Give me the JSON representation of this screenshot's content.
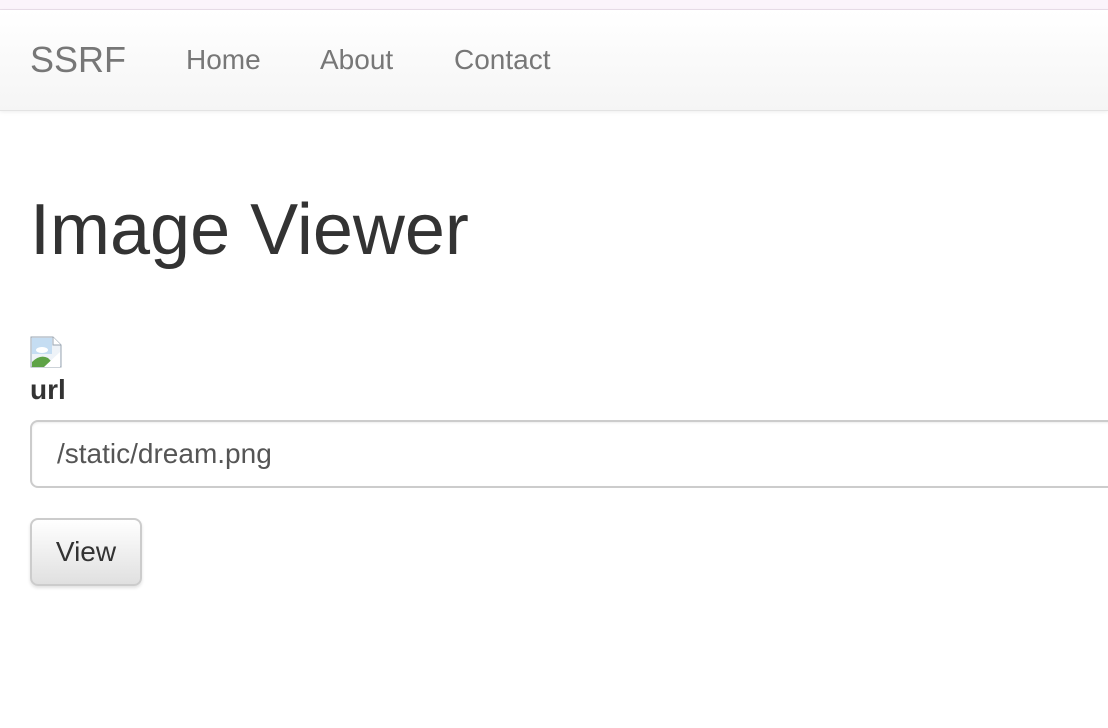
{
  "navbar": {
    "brand": "SSRF",
    "links": [
      {
        "label": "Home"
      },
      {
        "label": "About"
      },
      {
        "label": "Contact"
      }
    ]
  },
  "main": {
    "title": "Image Viewer",
    "image": {
      "icon": "broken-image-icon"
    },
    "form": {
      "label": "url",
      "input_value": "/static/dream.png",
      "button_label": "View"
    }
  },
  "colors": {
    "navbar_text": "#777777",
    "body_text": "#333333",
    "input_border": "#cccccc",
    "top_strip": "#fbf4fb"
  }
}
